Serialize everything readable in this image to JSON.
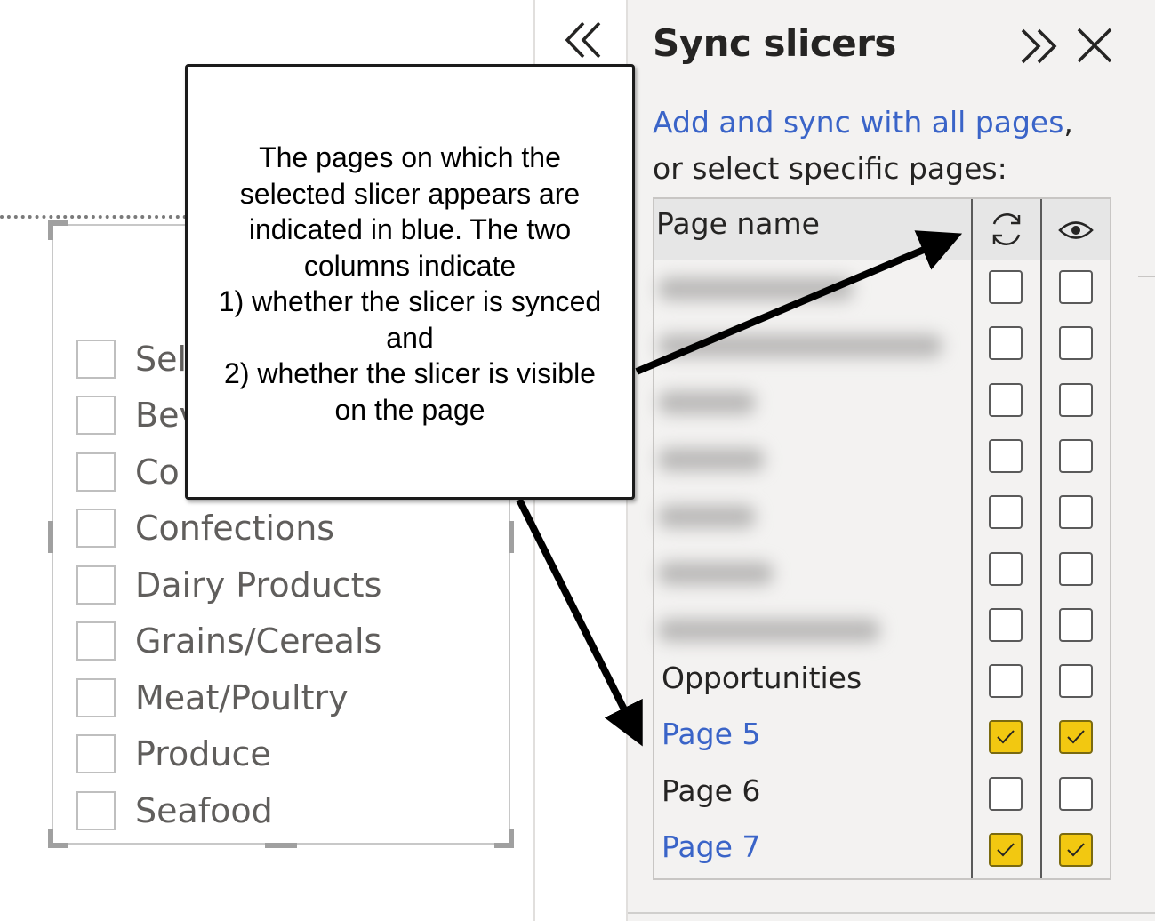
{
  "slicer": {
    "items": [
      {
        "label": "Sel"
      },
      {
        "label": "Bev"
      },
      {
        "label": "Co"
      },
      {
        "label": "Confections"
      },
      {
        "label": "Dairy Products"
      },
      {
        "label": "Grains/Cereals"
      },
      {
        "label": "Meat/Poultry"
      },
      {
        "label": "Produce"
      },
      {
        "label": "Seafood"
      }
    ]
  },
  "callout": {
    "lines": [
      "The pages on which the",
      "selected slicer appears are",
      "indicated in blue. The two",
      "columns indicate",
      "1) whether the slicer is synced",
      "and",
      "2) whether the slicer is visible",
      "on the page"
    ]
  },
  "pane": {
    "title": "Sync slicers",
    "link_text": "Add and sync with all pages",
    "link_suffix": ",",
    "desc_line2": "or select specific pages:",
    "table": {
      "header_label": "Page name",
      "sync_column_icon": "sync-icon",
      "visible_column_icon": "eye-icon",
      "rows": [
        {
          "name": "",
          "blurred": true,
          "sync": false,
          "visible": false
        },
        {
          "name": "",
          "blurred": true,
          "sync": false,
          "visible": false
        },
        {
          "name": "",
          "blurred": true,
          "sync": false,
          "visible": false
        },
        {
          "name": "",
          "blurred": true,
          "sync": false,
          "visible": false
        },
        {
          "name": "",
          "blurred": true,
          "sync": false,
          "visible": false
        },
        {
          "name": "",
          "blurred": true,
          "sync": false,
          "visible": false
        },
        {
          "name": "",
          "blurred": true,
          "sync": false,
          "visible": false
        },
        {
          "name": "Opportunities",
          "blurred": false,
          "sync": false,
          "visible": false
        },
        {
          "name": "Page 5",
          "blurred": false,
          "selected": true,
          "sync": true,
          "visible": true
        },
        {
          "name": "Page 6",
          "blurred": false,
          "sync": false,
          "visible": false
        },
        {
          "name": "Page 7",
          "blurred": false,
          "selected": true,
          "sync": true,
          "visible": true
        }
      ]
    }
  },
  "colors": {
    "selected_text": "#3a64c8",
    "checked_fill": "#f2c811",
    "pane_background": "#f3f2f1"
  }
}
